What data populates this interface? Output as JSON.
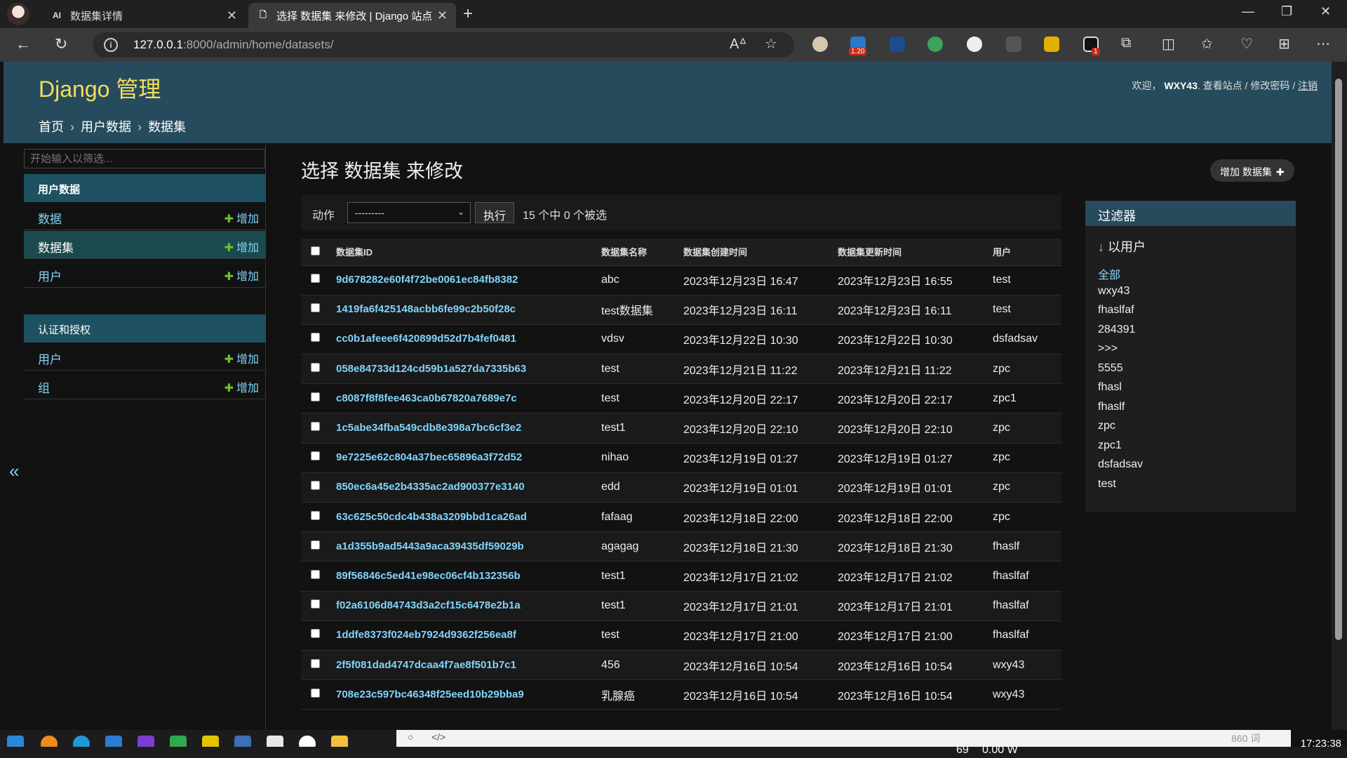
{
  "browser": {
    "tabs": [
      {
        "title": "数据集详情",
        "icon": "AI"
      },
      {
        "title": "选择 数据集 来修改 | Django 站点",
        "icon": "page-icon"
      }
    ],
    "url_host": "127.0.0.1",
    "url_rest": ":8000/admin/home/datasets/",
    "ext_badge_1": "1.20",
    "ext_badge_2": "1"
  },
  "header": {
    "brand": "Django 管理",
    "welcome": "欢迎，",
    "username": "WXY43",
    "view_site": "查看站点",
    "change_password": "修改密码",
    "logout": "注销",
    "sep": " / "
  },
  "breadcrumb": {
    "home": "首页",
    "app": "用户数据",
    "model": "数据集",
    "sep": "›"
  },
  "sidebar": {
    "filter_placeholder": "开始输入以筛选...",
    "modules": [
      {
        "caption": "用户数据",
        "items": [
          {
            "label": "数据",
            "add": "增加"
          },
          {
            "label": "数据集",
            "add": "增加"
          },
          {
            "label": "用户",
            "add": "增加"
          }
        ]
      },
      {
        "caption": "认证和授权",
        "items": [
          {
            "label": "用户",
            "add": "增加"
          },
          {
            "label": "组",
            "add": "增加"
          }
        ]
      }
    ],
    "collapse": "«"
  },
  "content": {
    "title": "选择 数据集 来修改",
    "add_button": "增加 数据集",
    "action_label": "动作",
    "action_selected": "---------",
    "go_button": "执行",
    "selection_count": "15 个中 0 个被选"
  },
  "table": {
    "headers": [
      "数据集ID",
      "数据集名称",
      "数据集创建时间",
      "数据集更新时间",
      "用户"
    ],
    "rows": [
      [
        "9d678282e60f4f72be0061ec84fb8382",
        "abc",
        "2023年12月23日 16:47",
        "2023年12月23日 16:55",
        "test"
      ],
      [
        "1419fa6f425148acbb6fe99c2b50f28c",
        "test数据集",
        "2023年12月23日 16:11",
        "2023年12月23日 16:11",
        "test"
      ],
      [
        "cc0b1afeee6f420899d52d7b4fef0481",
        "vdsv",
        "2023年12月22日 10:30",
        "2023年12月22日 10:30",
        "dsfadsav"
      ],
      [
        "058e84733d124cd59b1a527da7335b63",
        "test",
        "2023年12月21日 11:22",
        "2023年12月21日 11:22",
        "zpc"
      ],
      [
        "c8087f8f8fee463ca0b67820a7689e7c",
        "test",
        "2023年12月20日 22:17",
        "2023年12月20日 22:17",
        "zpc1"
      ],
      [
        "1c5abe34fba549cdb8e398a7bc6cf3e2",
        "test1",
        "2023年12月20日 22:10",
        "2023年12月20日 22:10",
        "zpc"
      ],
      [
        "9e7225e62c804a37bec65896a3f72d52",
        "nihao",
        "2023年12月19日 01:27",
        "2023年12月19日 01:27",
        "zpc"
      ],
      [
        "850ec6a45e2b4335ac2ad900377e3140",
        "edd",
        "2023年12月19日 01:01",
        "2023年12月19日 01:01",
        "zpc"
      ],
      [
        "63c625c50cdc4b438a3209bbd1ca26ad",
        "fafaag",
        "2023年12月18日 22:00",
        "2023年12月18日 22:00",
        "zpc"
      ],
      [
        "a1d355b9ad5443a9aca39435df59029b",
        "agagag",
        "2023年12月18日 21:30",
        "2023年12月18日 21:30",
        "fhaslf"
      ],
      [
        "89f56846c5ed41e98ec06cf4b132356b",
        "test1",
        "2023年12月17日 21:02",
        "2023年12月17日 21:02",
        "fhaslfaf"
      ],
      [
        "f02a6106d84743d3a2cf15c6478e2b1a",
        "test1",
        "2023年12月17日 21:01",
        "2023年12月17日 21:01",
        "fhaslfaf"
      ],
      [
        "1ddfe8373f024eb7924d9362f256ea8f",
        "test",
        "2023年12月17日 21:00",
        "2023年12月17日 21:00",
        "fhaslfaf"
      ],
      [
        "2f5f081dad4747dcaa4f7ae8f501b7c1",
        "456",
        "2023年12月16日 10:54",
        "2023年12月16日 10:54",
        "wxy43"
      ],
      [
        "708e23c597bc46348f25eed10b29bba9",
        "乳腺癌",
        "2023年12月16日 10:54",
        "2023年12月16日 10:54",
        "wxy43"
      ]
    ]
  },
  "filter": {
    "title": "过滤器",
    "arrow": "↓",
    "by": "以用户",
    "items": [
      "全部",
      "wxy43",
      "fhaslfaf",
      "284391",
      ">>>",
      "5555",
      "fhasl",
      "fhaslf",
      "zpc",
      "zpc1",
      "dsfadsav",
      "test"
    ]
  },
  "statusbar": {
    "word_count": "860 词",
    "battery": "69",
    "power": "0.00 W",
    "clock": "17:23:38"
  }
}
